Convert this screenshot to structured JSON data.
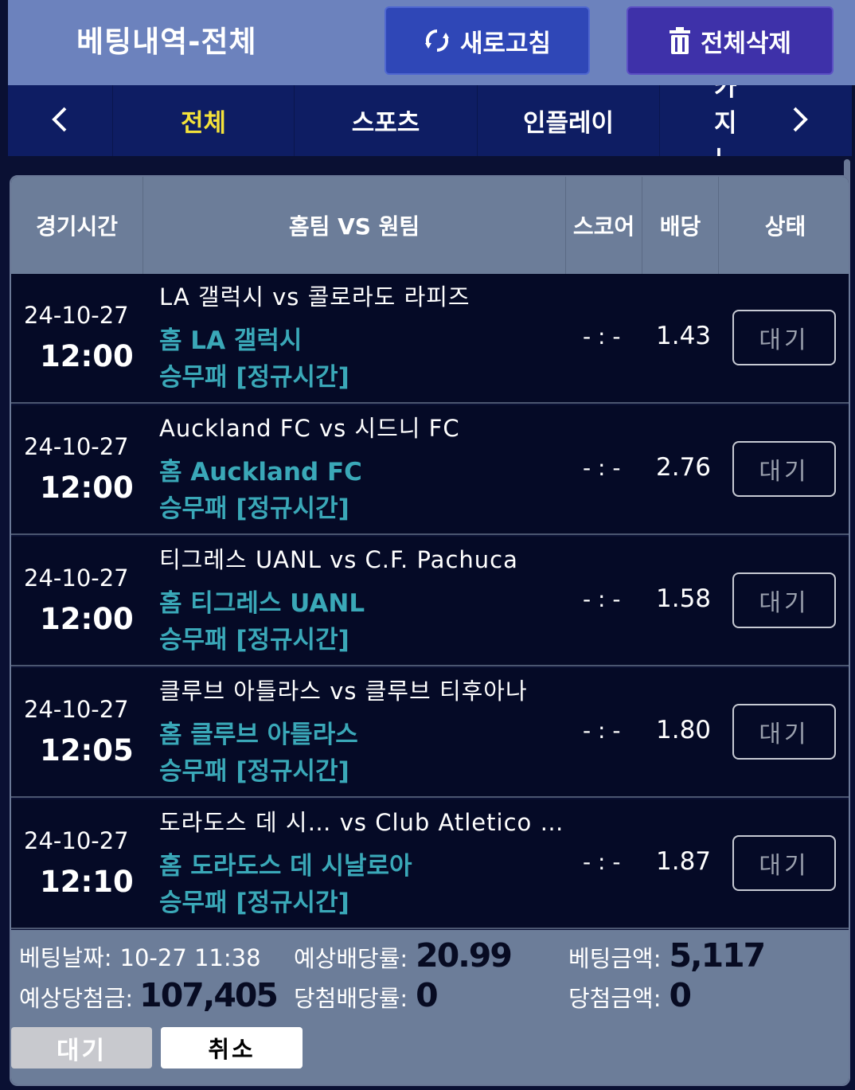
{
  "header": {
    "title": "베팅내역-전체",
    "refresh_label": "새로고침",
    "refresh_icon": "refresh-icon",
    "delete_all_label": "전체삭제",
    "delete_icon": "trash-icon"
  },
  "tabs": {
    "items": [
      {
        "label": "전체",
        "active": true
      },
      {
        "label": "스포츠",
        "active": false
      },
      {
        "label": "인플레이",
        "active": false
      },
      {
        "label": "카지노",
        "active": false
      }
    ],
    "prev_icon": "chevron-left-icon",
    "next_icon": "chevron-right-icon"
  },
  "table": {
    "headers": [
      "경기시간",
      "홈팀 VS 원팀",
      "스코어",
      "배당",
      "상태"
    ],
    "rows": [
      {
        "date": "24-10-27",
        "time": "12:00",
        "match": "LA 갤럭시 vs 콜로라도 라피즈",
        "pick": "홈 LA 갤럭시",
        "bet_type": "승무패 [정규시간]",
        "score": "- : -",
        "odds": "1.43",
        "status": "대기"
      },
      {
        "date": "24-10-27",
        "time": "12:00",
        "match": "Auckland FC vs 시드니 FC",
        "pick": "홈 Auckland FC",
        "bet_type": "승무패 [정규시간]",
        "score": "- : -",
        "odds": "2.76",
        "status": "대기"
      },
      {
        "date": "24-10-27",
        "time": "12:00",
        "match": "티그레스 UANL vs C.F. Pachuca",
        "pick": "홈 티그레스 UANL",
        "bet_type": "승무패 [정규시간]",
        "score": "- : -",
        "odds": "1.58",
        "status": "대기"
      },
      {
        "date": "24-10-27",
        "time": "12:05",
        "match": "클루브 아틀라스 vs 클루브 티후아나",
        "pick": "홈 클루브 아틀라스",
        "bet_type": "승무패 [정규시간]",
        "score": "- : -",
        "odds": "1.80",
        "status": "대기"
      },
      {
        "date": "24-10-27",
        "time": "12:10",
        "match": "도라도스 데 시… vs Club Atletico …",
        "pick": "홈 도라도스 데 시날로아",
        "bet_type": "승무패 [정규시간]",
        "score": "- : -",
        "odds": "1.87",
        "status": "대기"
      }
    ]
  },
  "summary": {
    "bet_date_label": "베팅날짜:",
    "bet_date": "10-27 11:38",
    "expected_odds_label": "예상배당률:",
    "expected_odds": "20.99",
    "bet_amount_label": "베팅금액:",
    "bet_amount": "5,117",
    "expected_win_label": "예상당첨금:",
    "expected_win": "107,405",
    "win_odds_label": "당첨배당률:",
    "win_odds": "0",
    "win_amount_label": "당첨금액:",
    "win_amount": "0",
    "status_button": "대기",
    "cancel_button": "취소"
  }
}
